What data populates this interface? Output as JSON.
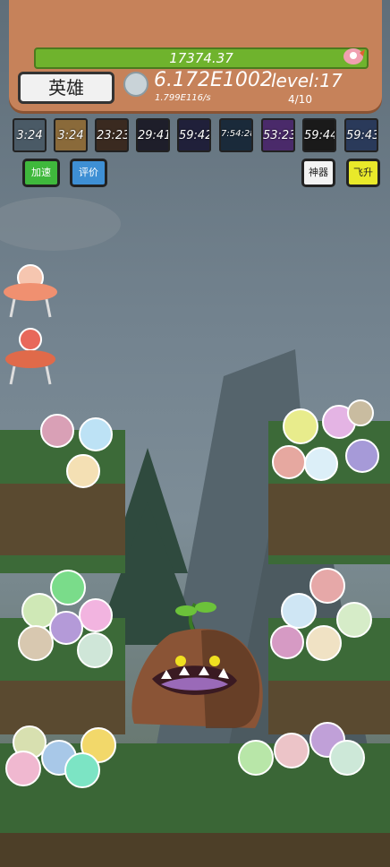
{
  "boss": {
    "hp_text": "17374.37"
  },
  "hero_button": {
    "label": "英雄"
  },
  "currency": {
    "gold": "6.172E1002",
    "rate": "1.799E116/s"
  },
  "level": {
    "label": "level:17",
    "wave": "4/10"
  },
  "skills": [
    {
      "timer": "3:24",
      "color": "#4a5a66"
    },
    {
      "timer": "3:24",
      "color": "#8a6a3a"
    },
    {
      "timer": "23:23",
      "color": "#3a2a20"
    },
    {
      "timer": "29:41",
      "color": "#1e1e2a"
    },
    {
      "timer": "59:42",
      "color": "#20203a"
    },
    {
      "timer": "7:54:28",
      "color": "#1a2a3a"
    },
    {
      "timer": "53:23",
      "color": "#4a2a6a"
    },
    {
      "timer": "59:44",
      "color": "#1a1a1a"
    },
    {
      "timer": "59:43",
      "color": "#2a3a5a"
    }
  ],
  "buttons": {
    "speed": "加速",
    "rate": "评价",
    "artifact": "神器",
    "ascend": "飞升"
  },
  "colors": {
    "panel": "#c6825a",
    "hp": "#6fb32d",
    "green_btn": "#3fb83c",
    "blue_btn": "#3e8fd4",
    "yellow_btn": "#e9e92a"
  }
}
